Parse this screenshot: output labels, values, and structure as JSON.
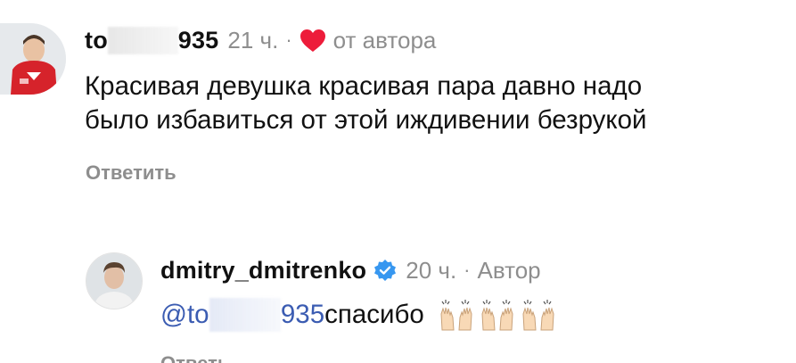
{
  "comments": [
    {
      "username_start": "to",
      "username_end": "935",
      "time": "21 ч.",
      "separator": "·",
      "liked_by_author_label": "от автора",
      "text_line1": "Красивая девушка красивая пара  давно надо",
      "text_line2": "было избавиться от этой иждивении безрукой",
      "reply_label": "Ответить",
      "avatar_icon": "child-red-sweater-avatar"
    },
    {
      "username": "dmitry_dmitrenko",
      "verified_icon": "verified-badge-icon",
      "time": "20 ч.",
      "separator": "·",
      "author_label": "Автор",
      "mention_start": "@to",
      "mention_end": "935",
      "text": " спасибо",
      "emoji": "raising-hands x3",
      "reply_label": "Ответить",
      "avatar_icon": "man-portrait-avatar"
    }
  ],
  "colors": {
    "primary_text": "#111111",
    "secondary_text": "#8e8e8e",
    "heart": "#ed1c3a",
    "mention": "#3b5cb2",
    "verified": "#3797f0"
  }
}
